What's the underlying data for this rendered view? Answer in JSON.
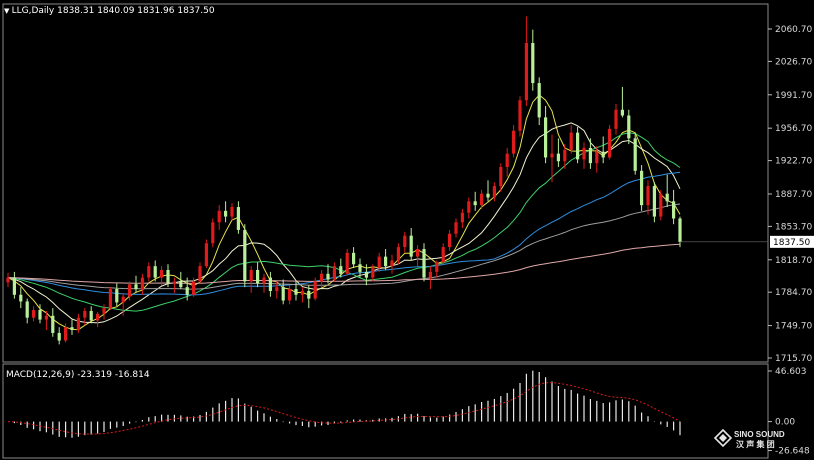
{
  "header": {
    "symbol": "LLG,Daily",
    "ohlc": "1838.31 1840.09 1831.96 1837.50"
  },
  "macd_header": "MACD(12,26,9) -23.319 -16.814",
  "watermark": {
    "line1": "SINO SOUND",
    "line2": "汉 声 集 团"
  },
  "colors": {
    "background": "#000000",
    "up_candle": "#e01b1b",
    "down_candle": "#b9ef9a",
    "ma_5": "#e8e34a",
    "ma_10": "#f2f2d2",
    "ma_20": "#3fd26a",
    "ma_40": "#2f8fe0",
    "ma_60": "#9e9e9e",
    "ma_120": "#e0a8a8",
    "macd_hist": "#e8e8e8",
    "macd_signal": "#e01b1b",
    "price_tag": "#ffffff"
  },
  "chart_data": [
    {
      "type": "candlestick",
      "title": "LLG,Daily",
      "y_ticks": [
        "2060.70",
        "2026.70",
        "1991.70",
        "1956.70",
        "1922.70",
        "1887.70",
        "1853.70",
        "1818.70",
        "1784.70",
        "1749.70",
        "1715.70"
      ],
      "ylim": [
        1712.0,
        2080.0
      ],
      "last_price": "1837.50",
      "candles": [
        [
          1795,
          1805,
          1790,
          1800
        ],
        [
          1800,
          1806,
          1778,
          1782
        ],
        [
          1782,
          1790,
          1768,
          1775
        ],
        [
          1775,
          1778,
          1752,
          1758
        ],
        [
          1758,
          1770,
          1754,
          1766
        ],
        [
          1766,
          1772,
          1752,
          1756
        ],
        [
          1756,
          1765,
          1745,
          1760
        ],
        [
          1760,
          1768,
          1738,
          1742
        ],
        [
          1742,
          1748,
          1730,
          1734
        ],
        [
          1734,
          1752,
          1732,
          1748
        ],
        [
          1748,
          1756,
          1740,
          1745
        ],
        [
          1745,
          1762,
          1742,
          1758
        ],
        [
          1758,
          1768,
          1750,
          1765
        ],
        [
          1765,
          1770,
          1752,
          1755
        ],
        [
          1755,
          1764,
          1748,
          1762
        ],
        [
          1762,
          1772,
          1756,
          1768
        ],
        [
          1768,
          1790,
          1766,
          1788
        ],
        [
          1788,
          1794,
          1770,
          1774
        ],
        [
          1774,
          1784,
          1760,
          1780
        ],
        [
          1780,
          1796,
          1776,
          1793
        ],
        [
          1793,
          1802,
          1784,
          1788
        ],
        [
          1788,
          1804,
          1782,
          1800
        ],
        [
          1800,
          1816,
          1796,
          1812
        ],
        [
          1812,
          1818,
          1796,
          1800
        ],
        [
          1800,
          1812,
          1792,
          1808
        ],
        [
          1808,
          1814,
          1790,
          1794
        ],
        [
          1794,
          1800,
          1784,
          1796
        ],
        [
          1796,
          1806,
          1788,
          1790
        ],
        [
          1790,
          1800,
          1776,
          1782
        ],
        [
          1782,
          1800,
          1780,
          1796
        ],
        [
          1796,
          1816,
          1794,
          1812
        ],
        [
          1812,
          1840,
          1810,
          1836
        ],
        [
          1836,
          1862,
          1832,
          1858
        ],
        [
          1858,
          1876,
          1850,
          1870
        ],
        [
          1870,
          1880,
          1858,
          1864
        ],
        [
          1864,
          1878,
          1860,
          1874
        ],
        [
          1874,
          1880,
          1846,
          1850
        ],
        [
          1850,
          1856,
          1790,
          1796
        ],
        [
          1796,
          1812,
          1784,
          1808
        ],
        [
          1808,
          1816,
          1790,
          1794
        ],
        [
          1794,
          1804,
          1784,
          1800
        ],
        [
          1800,
          1806,
          1780,
          1786
        ],
        [
          1786,
          1796,
          1778,
          1790
        ],
        [
          1790,
          1798,
          1772,
          1776
        ],
        [
          1776,
          1792,
          1772,
          1788
        ],
        [
          1788,
          1796,
          1776,
          1782
        ],
        [
          1782,
          1790,
          1774,
          1786
        ],
        [
          1786,
          1792,
          1768,
          1778
        ],
        [
          1778,
          1800,
          1776,
          1796
        ],
        [
          1796,
          1808,
          1790,
          1804
        ],
        [
          1804,
          1814,
          1794,
          1798
        ],
        [
          1798,
          1816,
          1796,
          1812
        ],
        [
          1812,
          1820,
          1800,
          1804
        ],
        [
          1804,
          1830,
          1802,
          1826
        ],
        [
          1826,
          1832,
          1810,
          1814
        ],
        [
          1814,
          1820,
          1800,
          1806
        ],
        [
          1806,
          1814,
          1792,
          1800
        ],
        [
          1800,
          1814,
          1796,
          1810
        ],
        [
          1810,
          1826,
          1806,
          1822
        ],
        [
          1822,
          1830,
          1808,
          1812
        ],
        [
          1812,
          1824,
          1804,
          1818
        ],
        [
          1818,
          1836,
          1814,
          1832
        ],
        [
          1832,
          1848,
          1826,
          1844
        ],
        [
          1844,
          1852,
          1818,
          1822
        ],
        [
          1822,
          1834,
          1812,
          1830
        ],
        [
          1830,
          1836,
          1796,
          1800
        ],
        [
          1800,
          1812,
          1788,
          1806
        ],
        [
          1806,
          1818,
          1800,
          1816
        ],
        [
          1816,
          1836,
          1814,
          1832
        ],
        [
          1832,
          1850,
          1828,
          1846
        ],
        [
          1846,
          1862,
          1842,
          1858
        ],
        [
          1858,
          1872,
          1852,
          1868
        ],
        [
          1868,
          1884,
          1862,
          1880
        ],
        [
          1880,
          1890,
          1870,
          1876
        ],
        [
          1876,
          1892,
          1872,
          1888
        ],
        [
          1888,
          1902,
          1880,
          1884
        ],
        [
          1884,
          1900,
          1880,
          1896
        ],
        [
          1896,
          1920,
          1890,
          1916
        ],
        [
          1916,
          1936,
          1906,
          1930
        ],
        [
          1930,
          1960,
          1926,
          1954
        ],
        [
          1954,
          1990,
          1948,
          1986
        ],
        [
          1986,
          2074,
          1980,
          2046
        ],
        [
          2046,
          2060,
          1996,
          2004
        ],
        [
          2004,
          2010,
          1960,
          1968
        ],
        [
          1968,
          1980,
          1920,
          1926
        ],
        [
          1926,
          1950,
          1900,
          1930
        ],
        [
          1930,
          1946,
          1916,
          1922
        ],
        [
          1922,
          1940,
          1914,
          1934
        ],
        [
          1934,
          1960,
          1930,
          1952
        ],
        [
          1952,
          1958,
          1920,
          1924
        ],
        [
          1924,
          1942,
          1914,
          1936
        ],
        [
          1936,
          1946,
          1914,
          1920
        ],
        [
          1920,
          1938,
          1910,
          1932
        ],
        [
          1932,
          1948,
          1920,
          1926
        ],
        [
          1926,
          1960,
          1924,
          1956
        ],
        [
          1956,
          1982,
          1950,
          1976
        ],
        [
          1976,
          2000,
          1968,
          1970
        ],
        [
          1970,
          1976,
          1940,
          1946
        ],
        [
          1946,
          1952,
          1908,
          1912
        ],
        [
          1912,
          1918,
          1870,
          1876
        ],
        [
          1876,
          1902,
          1866,
          1896
        ],
        [
          1896,
          1900,
          1858,
          1864
        ],
        [
          1864,
          1892,
          1860,
          1888
        ],
        [
          1888,
          1908,
          1874,
          1880
        ],
        [
          1880,
          1892,
          1856,
          1862
        ],
        [
          1862,
          1864,
          1832,
          1837.5
        ]
      ],
      "moving_averages": [
        {
          "color_key": "ma_5",
          "period": 5
        },
        {
          "color_key": "ma_10",
          "period": 10
        },
        {
          "color_key": "ma_20",
          "period": 20
        },
        {
          "color_key": "ma_40",
          "period": 40
        },
        {
          "color_key": "ma_60",
          "period": 60
        },
        {
          "color_key": "ma_120",
          "period": 120
        }
      ]
    },
    {
      "type": "bar",
      "title": "MACD(12,26,9) -23.319 -16.814",
      "y_ticks": [
        "46.603",
        "0.00",
        "-26.648"
      ],
      "ylim": [
        -28.0,
        46.6
      ],
      "macd_value": -23.319,
      "signal_value": -16.814
    }
  ]
}
